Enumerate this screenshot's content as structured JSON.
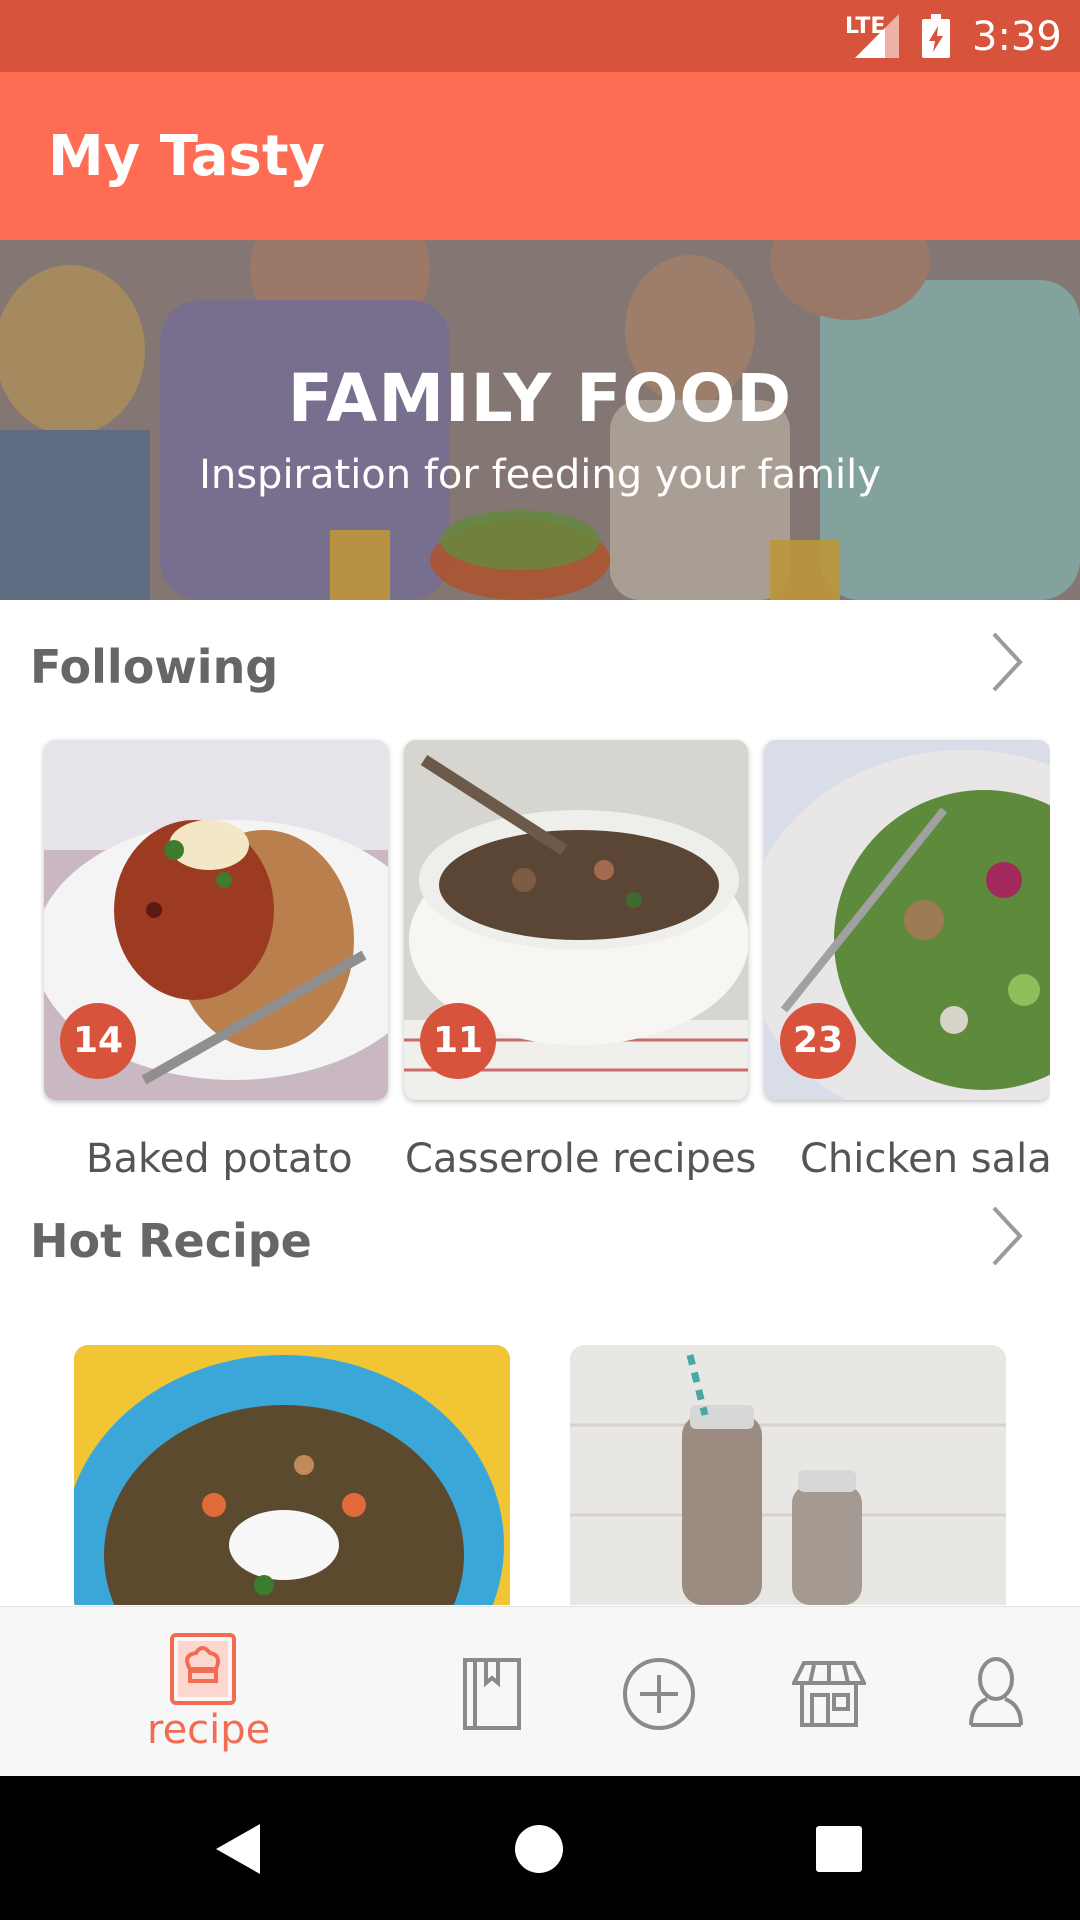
{
  "status_bar": {
    "network": "LTE",
    "time": "3:39"
  },
  "app_bar": {
    "title": "My Tasty"
  },
  "hero": {
    "heading": "FAMILY FOOD",
    "subtitle": "Inspiration for feeding your family"
  },
  "following": {
    "title": "Following",
    "items": [
      {
        "label": "Baked potato",
        "count": "14"
      },
      {
        "label": "Casserole recipes",
        "count": "11"
      },
      {
        "label": "Chicken salad",
        "count": "23"
      }
    ]
  },
  "hot_recipe": {
    "title": "Hot Recipe"
  },
  "bottom_nav": {
    "active_label": "recipe",
    "items": [
      "recipe-icon",
      "notebook-icon",
      "add-icon",
      "shop-icon",
      "profile-icon"
    ]
  },
  "colors": {
    "accent": "#fe6c53",
    "status": "#d8533b",
    "badge": "#d8533b"
  }
}
